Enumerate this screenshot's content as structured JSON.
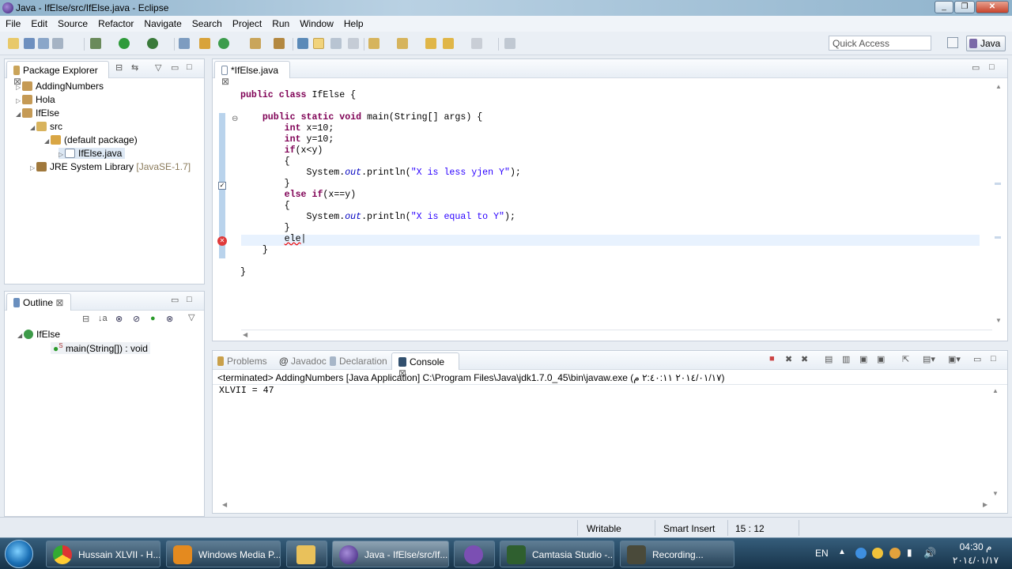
{
  "window": {
    "title": "Java - IfElse/src/IfElse.java - Eclipse"
  },
  "menu": [
    "File",
    "Edit",
    "Source",
    "Refactor",
    "Navigate",
    "Search",
    "Project",
    "Run",
    "Window",
    "Help"
  ],
  "quick_access": {
    "placeholder": "Quick Access"
  },
  "perspective": "Java",
  "package_explorer": {
    "title": "Package Explorer",
    "items": [
      {
        "label": "AddingNumbers",
        "extra": ""
      },
      {
        "label": "Hola",
        "extra": ""
      },
      {
        "label": "IfElse",
        "extra": ""
      },
      {
        "label": "src",
        "extra": ""
      },
      {
        "label": "(default package)",
        "extra": ""
      },
      {
        "label": "IfElse.java",
        "extra": ""
      },
      {
        "label": "JRE System Library",
        "extra": "[JavaSE-1.7]"
      }
    ]
  },
  "outline": {
    "title": "Outline",
    "class_name": "IfElse",
    "method": "main(String[]) : void",
    "method_sup": "S"
  },
  "editor": {
    "tab": "*IfElse.java",
    "lines": [
      "public class IfElse {",
      "",
      "    public static void main(String[] args) {",
      "        int x=10;",
      "        int y=10;",
      "        if(x<y)",
      "        {",
      "            System.out.println(\"X is less yjen Y\");",
      "        }",
      "        else if(x==y)",
      "        {",
      "            System.out.println(\"X is equal to Y\");",
      "        }",
      "        ele",
      "    }",
      "",
      "}"
    ]
  },
  "console": {
    "tabs": [
      "Problems",
      "Javadoc",
      "Declaration",
      "Console"
    ],
    "active_tab": "Console",
    "header": "<terminated> AddingNumbers [Java Application] C:\\Program Files\\Java\\jdk1.7.0_45\\bin\\javaw.exe (٢٠١٤/٠١/١٧ ٢:٤٠:١١ م)",
    "output": "XLVII = 47"
  },
  "status": {
    "mode": "Writable",
    "insert": "Smart Insert",
    "position": "15 : 12"
  },
  "taskbar": {
    "items": [
      "Hussain XLVII - H...",
      "Windows Media P...",
      "",
      "Java - IfElse/src/If...",
      "",
      "Camtasia Studio -...",
      "Recording..."
    ],
    "lang": "EN",
    "time": "04:30 م",
    "date": "٢٠١٤/٠١/١٧"
  },
  "colors": {
    "keyword": "#7f0055",
    "string": "#2a00ff",
    "static_field": "#0000c0",
    "taskbar": "#1f4058"
  }
}
